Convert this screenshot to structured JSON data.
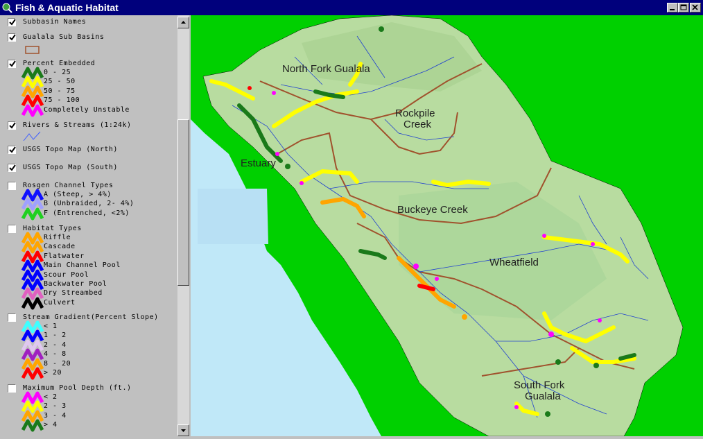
{
  "window": {
    "title": "Fish & Aquatic Habitat"
  },
  "legend": {
    "layers": [
      {
        "name": "Subbasin Names",
        "checked": true
      },
      {
        "name": "Gualala Sub Basins",
        "checked": true,
        "symbol_color": "#a0522d"
      },
      {
        "name": "Percent Embedded",
        "checked": true,
        "classes": [
          {
            "label": "0 - 25",
            "color": "#1a7a1a"
          },
          {
            "label": "25 - 50",
            "color": "#ffff00"
          },
          {
            "label": "50 - 75",
            "color": "#ffa500"
          },
          {
            "label": "75 - 100",
            "color": "#ff0000"
          },
          {
            "label": "Completely Unstable",
            "color": "#ff00ff"
          }
        ]
      },
      {
        "name": "Rivers & Streams (1:24k)",
        "checked": true,
        "symbol_color": "#4060ff"
      },
      {
        "name": "USGS Topo Map (North)",
        "checked": true
      },
      {
        "name": "USGS Topo Map (South)",
        "checked": true
      },
      {
        "name": "Rosgen Channel Types",
        "checked": false,
        "classes": [
          {
            "label": "A (Steep, > 4%)",
            "color": "#1010ff"
          },
          {
            "label": "B (Unbraided, 2- 4%)",
            "color": "#a0a0ff"
          },
          {
            "label": "F (Entrenched, <2%)",
            "color": "#20d020"
          }
        ]
      },
      {
        "name": "Habitat Types",
        "checked": false,
        "classes": [
          {
            "label": "Riffle",
            "color": "#ffa500"
          },
          {
            "label": "Cascade",
            "color": "#ffa500"
          },
          {
            "label": "Flatwater",
            "color": "#ff0000"
          },
          {
            "label": "Main Channel Pool",
            "color": "#0000ff"
          },
          {
            "label": "Scour Pool",
            "color": "#0000ff"
          },
          {
            "label": "Backwater Pool",
            "color": "#0000ff"
          },
          {
            "label": "Dry Streambed",
            "color": "#e060c0"
          },
          {
            "label": "Culvert",
            "color": "#000000"
          }
        ]
      },
      {
        "name": "Stream Gradient(Percent Slope)",
        "checked": false,
        "classes": [
          {
            "label": "< 1",
            "color": "#40ffff"
          },
          {
            "label": "1 - 2",
            "color": "#0000ff"
          },
          {
            "label": "2 - 4",
            "color": "#e0c8f0"
          },
          {
            "label": "4 - 8",
            "color": "#a020c0"
          },
          {
            "label": "8 - 20",
            "color": "#ffa500"
          },
          {
            "label": "> 20",
            "color": "#ff0000"
          }
        ]
      },
      {
        "name": "Maximum Pool Depth (ft.)",
        "checked": false,
        "classes": [
          {
            "label": "< 2",
            "color": "#ff00ff"
          },
          {
            "label": "2 - 3",
            "color": "#ffff00"
          },
          {
            "label": "3 - 4",
            "color": "#ffa500"
          },
          {
            "label": "> 4",
            "color": "#1a7a1a"
          }
        ]
      }
    ]
  },
  "map": {
    "labels": {
      "north_fork": "North Fork Gualala",
      "rockpile_1": "Rockpile",
      "rockpile_2": "Creek",
      "estuary": "Estuary",
      "buckeye": "Buckeye Creek",
      "wheatfield": "Wheatfield",
      "south_fork_1": "South Fork",
      "south_fork_2": "Gualala"
    },
    "colors": {
      "background": "#00d000",
      "ocean": "#c0e8f8",
      "land": "#b8dca0",
      "boundary": "#a0522d",
      "stream": "#2040d0"
    }
  }
}
